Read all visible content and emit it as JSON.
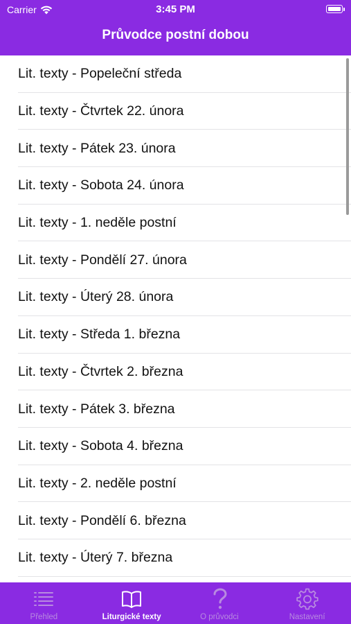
{
  "status_bar": {
    "carrier": "Carrier",
    "time": "3:45 PM"
  },
  "nav": {
    "title": "Průvodce postní dobou"
  },
  "colors": {
    "accent": "#8a2be2",
    "tab_inactive": "#b88ae0",
    "tab_active": "#ffffff"
  },
  "list": {
    "items": [
      "Lit. texty - Popeleční středa",
      "Lit. texty - Čtvrtek 22. února",
      "Lit. texty - Pátek 23. února",
      "Lit. texty - Sobota 24. února",
      "Lit. texty - 1. neděle postní",
      "Lit. texty - Pondělí 27. února",
      "Lit. texty - Úterý 28. února",
      "Lit. texty - Středa 1. března",
      "Lit. texty - Čtvrtek 2. března",
      "Lit. texty - Pátek 3. března",
      "Lit. texty - Sobota 4. března",
      "Lit. texty - 2. neděle postní",
      "Lit. texty - Pondělí 6. března",
      "Lit. texty - Úterý 7. března"
    ]
  },
  "tabbar": {
    "tabs": [
      {
        "label": "Přehled",
        "icon": "list-icon",
        "active": false
      },
      {
        "label": "Liturgické texty",
        "icon": "book-icon",
        "active": true
      },
      {
        "label": "O průvodci",
        "icon": "question-icon",
        "active": false
      },
      {
        "label": "Nastavení",
        "icon": "gear-icon",
        "active": false
      }
    ]
  }
}
